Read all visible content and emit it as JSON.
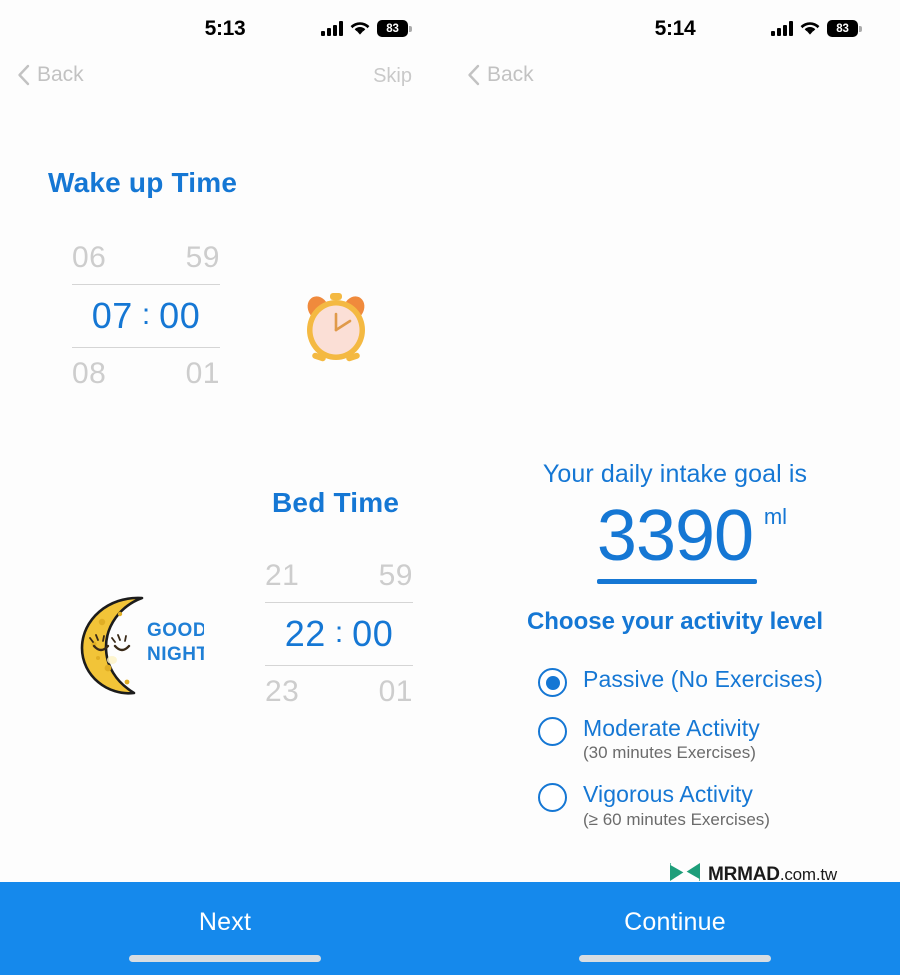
{
  "left_screen": {
    "status": {
      "time": "5:13",
      "battery": "83",
      "signal_icon": "cellular-bars-icon",
      "wifi_icon": "wifi-icon",
      "battery_icon": "battery-icon"
    },
    "nav": {
      "back_label": "Back",
      "skip_label": "Skip",
      "back_icon": "chevron-left-icon"
    },
    "wake": {
      "title": "Wake up Time",
      "prev_hour": "06",
      "prev_minute": "59",
      "hour": "07",
      "colon": ":",
      "minute": "00",
      "next_hour": "08",
      "next_minute": "01",
      "art_icon": "alarm-clock-icon"
    },
    "bed": {
      "title": "Bed Time",
      "prev_hour": "21",
      "prev_minute": "59",
      "hour": "22",
      "colon": ":",
      "minute": "00",
      "next_hour": "23",
      "next_minute": "01",
      "art_icon": "good-night-moon-icon",
      "art_text_line1": "GOOD",
      "art_text_line2": "NIGHT"
    },
    "cta": "Next"
  },
  "right_screen": {
    "status": {
      "time": "5:14",
      "battery": "83",
      "signal_icon": "cellular-bars-icon",
      "wifi_icon": "wifi-icon",
      "battery_icon": "battery-icon"
    },
    "nav": {
      "back_label": "Back",
      "back_icon": "chevron-left-icon"
    },
    "hero_icon": "flexed-bicep-dumbbell-icon",
    "goal": {
      "label": "Your daily intake goal is",
      "value": "3390",
      "unit": "ml"
    },
    "activity": {
      "title": "Choose your activity level",
      "options": [
        {
          "label": "Passive (No Exercises)",
          "sublabel": "",
          "selected": true
        },
        {
          "label": "Moderate Activity",
          "sublabel": "(30 minutes Exercises)",
          "selected": false
        },
        {
          "label": "Vigorous Activity",
          "sublabel": "(≥ 60 minutes Exercises)",
          "selected": false
        }
      ]
    },
    "cta": "Continue"
  },
  "watermark": {
    "brand": "MRMAD",
    "suffix": ".com.tw",
    "logo_icon": "mrmad-butterfly-logo-icon"
  },
  "colors": {
    "accent_blue": "#1577d4",
    "bar_blue": "#1589ec",
    "dim_gray": "#cdcdcd",
    "nav_gray": "#c2c2c2"
  }
}
